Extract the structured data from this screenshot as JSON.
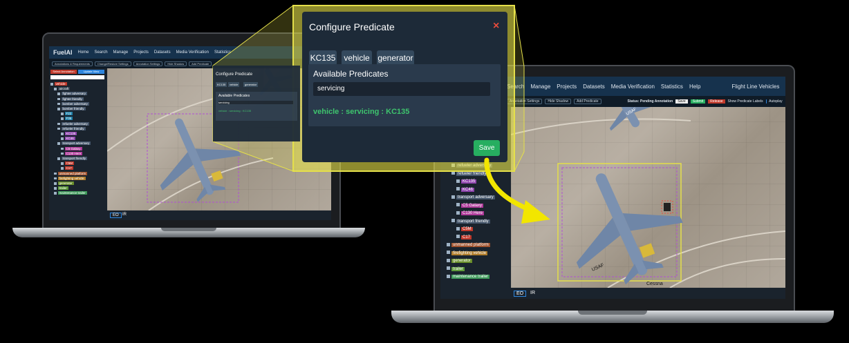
{
  "app": {
    "logo": "FuelAI",
    "nav": [
      "Home",
      "Search",
      "Manage",
      "Projects",
      "Datasets",
      "Media Verification",
      "Statistics",
      "Help"
    ],
    "user_label": "Flight Line Vehicles",
    "pages": [
      "Annotations & Requirements",
      "Change/Restore Settings",
      "Annotation Settings",
      "Hide Shadow",
      "Add Predicate"
    ],
    "status": "Status: Pending Annotation",
    "save": "Save",
    "submit": "Submit",
    "release": "Release",
    "show_predicate_labels": "Show Predicate Labels",
    "autoplay": "Autoplay",
    "sidebar_tabs": [
      "Select Annotation",
      "Update View"
    ],
    "bottom_tabs": [
      "EO",
      "IR"
    ]
  },
  "tree": [
    {
      "label": "vehicle",
      "level": 0,
      "color": "#c0392b"
    },
    {
      "label": "aircraft",
      "level": 1,
      "color": "#2e3e4e"
    },
    {
      "label": "fighter adversary",
      "level": 2,
      "color": "#44556a"
    },
    {
      "label": "fighter friendly",
      "level": 2,
      "color": "#44556a"
    },
    {
      "label": "bomber adversary",
      "level": 2,
      "color": "#44556a"
    },
    {
      "label": "bomber friendly",
      "level": 2,
      "color": "#44556a"
    },
    {
      "label": "F22",
      "level": 3,
      "color": "#1e7fa8"
    },
    {
      "label": "F35",
      "level": 3,
      "color": "#1e7fa8"
    },
    {
      "label": "refueler adversary",
      "level": 2,
      "color": "#44556a"
    },
    {
      "label": "refueler friendly",
      "level": 2,
      "color": "#44556a"
    },
    {
      "label": "KC135",
      "level": 3,
      "color": "#8e44ad"
    },
    {
      "label": "KC46",
      "level": 3,
      "color": "#8e44ad"
    },
    {
      "label": "transport adversary",
      "level": 2,
      "color": "#44556a"
    },
    {
      "label": "C5 Galaxy",
      "level": 3,
      "color": "#b03a9a"
    },
    {
      "label": "C130 Here",
      "level": 3,
      "color": "#b03a9a"
    },
    {
      "label": "transport friendly",
      "level": 2,
      "color": "#44556a"
    },
    {
      "label": "C5M",
      "level": 3,
      "color": "#c0392b"
    },
    {
      "label": "C17",
      "level": 3,
      "color": "#c0392b"
    },
    {
      "label": "unmanned platform",
      "level": 1,
      "color": "#a0522d"
    },
    {
      "label": "firefighting vehicle",
      "level": 1,
      "color": "#b07c2a"
    },
    {
      "label": "generator",
      "level": 1,
      "color": "#6a8f2a"
    },
    {
      "label": "trailer",
      "level": 1,
      "color": "#5e9a3a"
    },
    {
      "label": "maintenance trailer",
      "level": 1,
      "color": "#3e9a5a"
    }
  ],
  "modal": {
    "title": "Configure Predicate",
    "close": "×",
    "chips": [
      "KC135",
      "vehicle",
      "generator"
    ],
    "panel_title": "Available Predicates",
    "input_value": "servicing",
    "result": "vehicle : servicing : KC135",
    "save": "Save"
  },
  "aircraft_markings": [
    "USAF",
    "USAF"
  ],
  "object_label": "Cessna",
  "colors": {
    "accent_yellow": "#e5e04a",
    "predicate_green": "#3ec46d",
    "save_green": "#27ae60",
    "close_red": "#e74c3c",
    "nav_blue": "#16324d"
  }
}
